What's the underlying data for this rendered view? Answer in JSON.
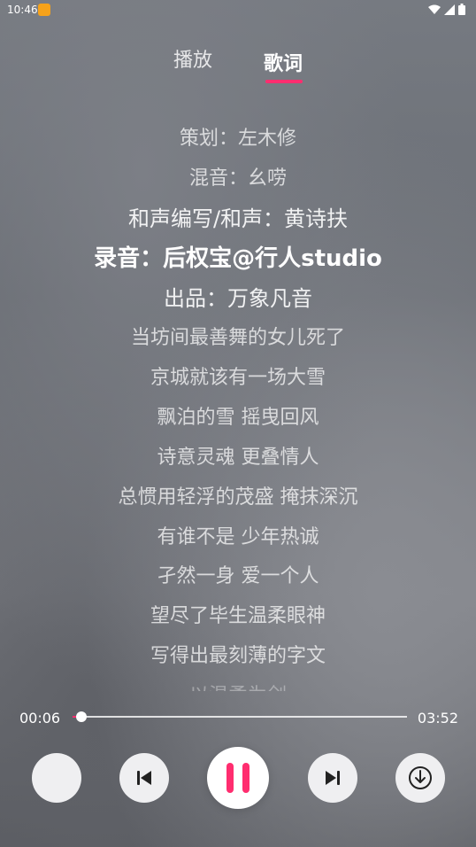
{
  "status_bar": {
    "time": "10:46"
  },
  "tabs": [
    {
      "label": "播放"
    },
    {
      "label": "歌词"
    }
  ],
  "lyrics": [
    "策划：左木修",
    "混音：幺唠",
    "和声编写/和声：黄诗扶",
    "录音：后权宝@行人studio",
    "出品：万象凡音",
    "当坊间最善舞的女儿死了",
    "京城就该有一场大雪",
    "飘泊的雪 摇曳回风",
    "诗意灵魂 更叠情人",
    "总惯用轻浮的茂盛 掩抹深沉",
    "有谁不是 少年热诚",
    "孑然一身 爱一个人",
    "望尽了毕生温柔眼神",
    "写得出最刻薄的字文",
    "以温柔为剑"
  ],
  "player": {
    "current_time": "00:06",
    "total_time": "03:52",
    "progress": 0.026
  },
  "colors": {
    "accent": "#ff2d6f"
  },
  "icons": {
    "prev": "skip-previous-icon",
    "play_pause": "pause-icon",
    "next": "skip-next-icon",
    "download": "download-icon"
  }
}
